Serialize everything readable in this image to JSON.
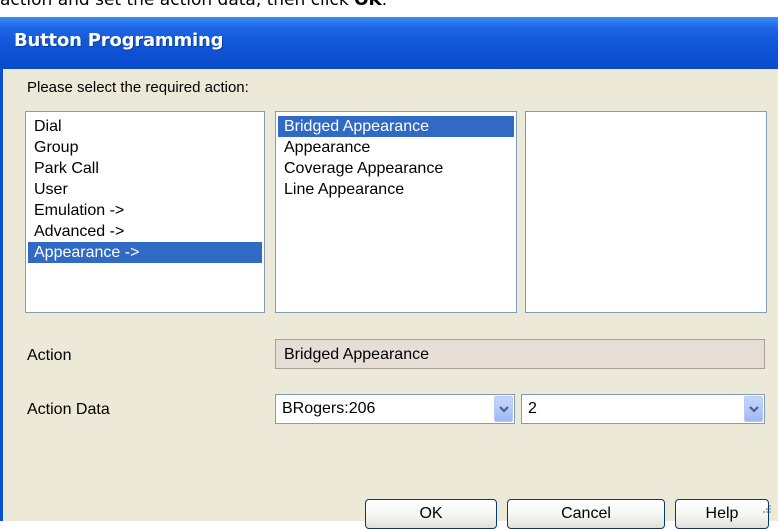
{
  "page_top_text": {
    "before": "action and set the action data, then click ",
    "bold": "OK",
    "after": "."
  },
  "dialog": {
    "title": "Button Programming",
    "instruction": "Please select the required action:",
    "list1": {
      "items": [
        "Dial",
        "Group",
        "Park Call",
        "User",
        "Emulation ->",
        "Advanced ->",
        "Appearance ->"
      ],
      "selected_index": 6
    },
    "list2": {
      "items": [
        "Bridged Appearance",
        "Appearance",
        "Coverage Appearance",
        "Line Appearance"
      ],
      "selected_index": 0
    },
    "list3": {
      "items": []
    },
    "action_label": "Action",
    "action_value": "Bridged Appearance",
    "action_data_label": "Action Data",
    "action_data_value1": "BRogers:206",
    "action_data_value2": "2",
    "buttons": {
      "ok": "OK",
      "cancel": "Cancel",
      "help": "Help"
    }
  },
  "colors": {
    "titlebar": "#0b4bcb",
    "selection": "#316ac5",
    "client_bg": "#ece9d8"
  }
}
